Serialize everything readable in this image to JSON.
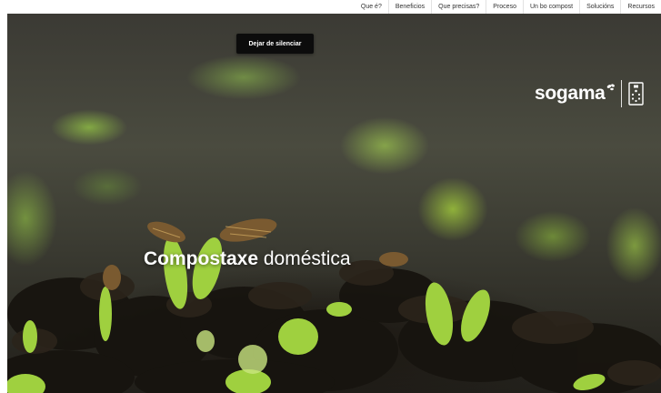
{
  "nav": {
    "items": [
      {
        "label": "Que é?"
      },
      {
        "label": "Beneficios"
      },
      {
        "label": "Que precisas?"
      },
      {
        "label": "Proceso"
      },
      {
        "label": "Un bo compost"
      },
      {
        "label": "Solucións"
      },
      {
        "label": "Recursos"
      }
    ]
  },
  "video": {
    "unmute_label": "Dejar de silenciar"
  },
  "logo": {
    "text": "sogama"
  },
  "hero": {
    "title_bold": "Compostaxe",
    "title_rest": " doméstica"
  },
  "colors": {
    "sprout_green": "#9fd03f",
    "soil_dark": "#211f1a",
    "nav_text": "#333333"
  },
  "icons": [
    "leaf-sparkle-icon",
    "galicia-shield-icon"
  ]
}
